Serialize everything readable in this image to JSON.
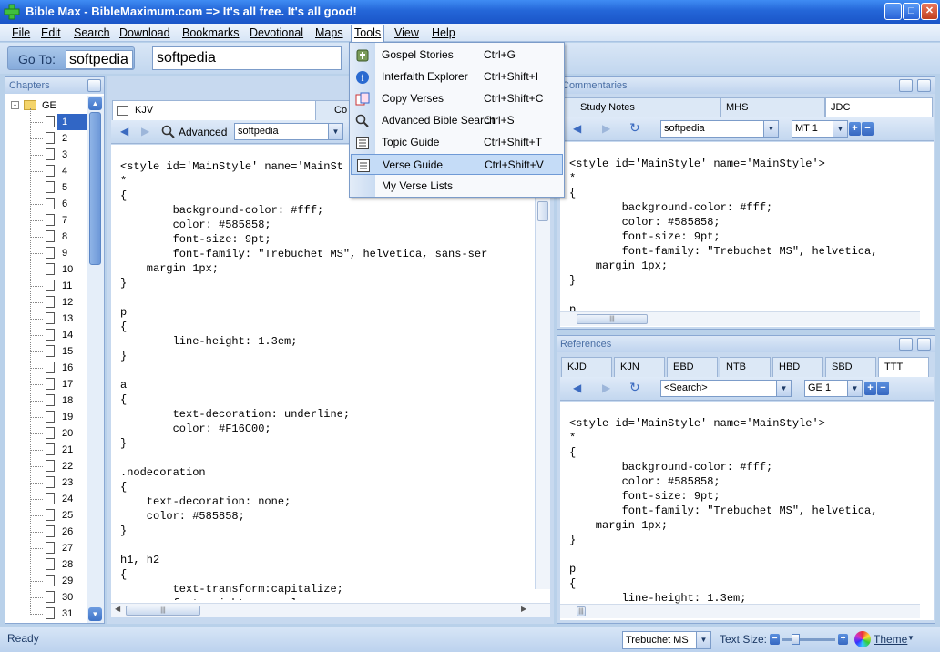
{
  "window": {
    "title": "Bible Max - BibleMaximum.com => It's all free. It's all good!"
  },
  "menu": {
    "items": [
      "File",
      "Edit",
      "Search",
      "Download",
      "Bookmarks",
      "Devotional",
      "Maps",
      "Tools",
      "View",
      "Help"
    ],
    "active": "Tools"
  },
  "goto": {
    "label": "Go To:",
    "value": "softpedia",
    "search_value": "softpedia"
  },
  "tools_menu": {
    "items": [
      {
        "label": "Gospel Stories",
        "shortcut": "Ctrl+G",
        "icon": "gospel-icon"
      },
      {
        "label": "Interfaith Explorer",
        "shortcut": "Ctrl+Shift+I",
        "icon": "info-icon"
      },
      {
        "label": "Copy Verses",
        "shortcut": "Ctrl+Shift+C",
        "icon": "copy-icon"
      },
      {
        "label": "Advanced Bible Search",
        "shortcut": "Ctrl+S",
        "icon": "search-icon"
      },
      {
        "label": "Topic Guide",
        "shortcut": "Ctrl+Shift+T",
        "icon": "list-icon"
      },
      {
        "label": "Verse Guide",
        "shortcut": "Ctrl+Shift+V",
        "icon": "list-icon"
      },
      {
        "label": "My Verse Lists",
        "shortcut": "",
        "icon": ""
      }
    ],
    "highlighted": "Verse Guide"
  },
  "chapters": {
    "title": "Chapters",
    "book": "GE",
    "numbers": [
      "1",
      "2",
      "3",
      "4",
      "5",
      "6",
      "7",
      "8",
      "9",
      "10",
      "11",
      "12",
      "13",
      "14",
      "15",
      "16",
      "17",
      "18",
      "19",
      "20",
      "21",
      "22",
      "23",
      "24",
      "25",
      "26",
      "27",
      "28",
      "29",
      "30",
      "31"
    ],
    "selected": "1"
  },
  "center": {
    "tabs": [
      "KJV",
      "Co"
    ],
    "advanced_label": "Advanced",
    "search_value": "softpedia",
    "code": "<style id='MainStyle' name='MainSt\n*\n{\n        background-color: #fff;\n        color: #585858;\n        font-size: 9pt;\n        font-family: \"Trebuchet MS\", helvetica, sans-ser\n    margin 1px;\n}\n\np\n{\n        line-height: 1.3em;\n}\n\na\n{\n        text-decoration: underline;\n        color: #F16C00;\n}\n\n.nodecoration\n{\n    text-decoration: none;\n    color: #585858;\n}\n\nh1, h2\n{\n        text-transform:capitalize;\n        font-weight: normal;"
  },
  "commentaries": {
    "title": "Commentaries",
    "tabs": [
      "Study Notes",
      "MHS",
      "JDC"
    ],
    "active_tab": "JDC",
    "search_value": "softpedia",
    "ref_value": "MT 1",
    "code": "<style id='MainStyle' name='MainStyle'>\n*\n{\n        background-color: #fff;\n        color: #585858;\n        font-size: 9pt;\n        font-family: \"Trebuchet MS\", helvetica,\n    margin 1px;\n}\n\np"
  },
  "references": {
    "title": "References",
    "tabs": [
      "KJD",
      "KJN",
      "EBD",
      "NTB",
      "HBD",
      "SBD",
      "TTT"
    ],
    "active_tab": "TTT",
    "search_value": "<Search>",
    "ref_value": "GE 1",
    "code": "<style id='MainStyle' name='MainStyle'>\n*\n{\n        background-color: #fff;\n        color: #585858;\n        font-size: 9pt;\n        font-family: \"Trebuchet MS\", helvetica,\n    margin 1px;\n}\n\np\n{\n        line-height: 1.3em;"
  },
  "status": {
    "text": "Ready",
    "font_value": "Trebuchet MS",
    "text_size_label": "Text Size:",
    "theme_label": "Theme"
  }
}
